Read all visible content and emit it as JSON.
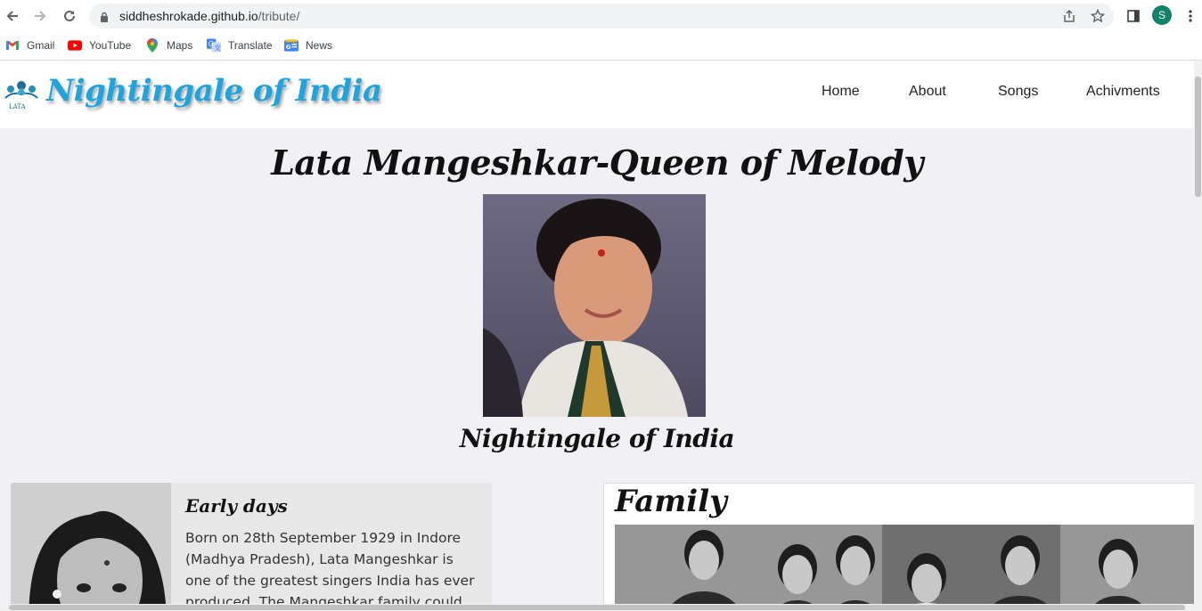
{
  "browser": {
    "url_host": "siddheshrokade.github.io",
    "url_path": "/tribute/",
    "profile_initial": "S",
    "bookmarks": [
      {
        "label": "Gmail",
        "icon": "gmail-icon"
      },
      {
        "label": "YouTube",
        "icon": "youtube-icon"
      },
      {
        "label": "Maps",
        "icon": "maps-icon"
      },
      {
        "label": "Translate",
        "icon": "translate-icon"
      },
      {
        "label": "News",
        "icon": "news-icon"
      }
    ]
  },
  "site": {
    "logo_text": "Nightingale of India",
    "logo_small": "LATA",
    "nav": [
      "Home",
      "About",
      "Songs",
      "Achivments"
    ]
  },
  "hero": {
    "title": "Lata Mangeshkar-Queen of Melody",
    "caption": "Nightingale of India"
  },
  "early_days": {
    "title": "Early days",
    "text": "Born on 28th September 1929 in Indore (Madhya Pradesh), Lata Mangeshkar is one of the greatest singers India has ever produced. The Mangeshkar family could very well be"
  },
  "family": {
    "title": "Family"
  },
  "colors": {
    "logo_blue": "#1ea5e0",
    "page_bg": "#f0f0f5",
    "avatar_green": "#12836b"
  }
}
